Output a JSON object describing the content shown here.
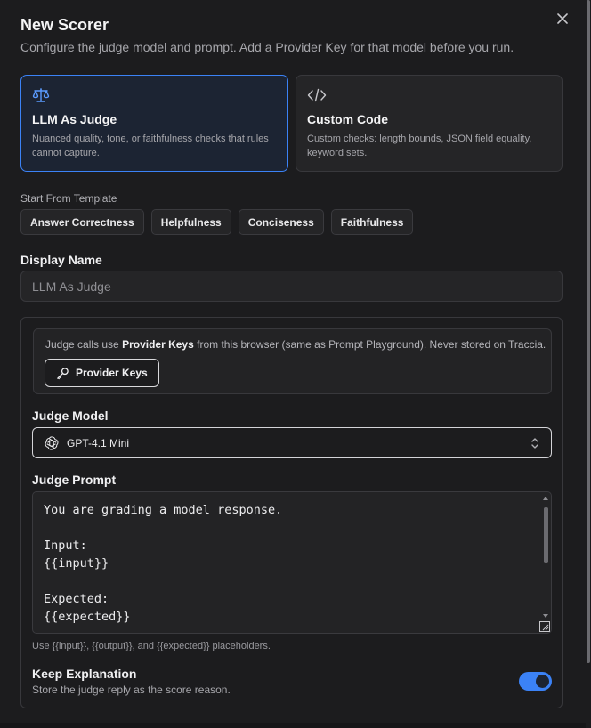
{
  "dialog": {
    "title": "New Scorer",
    "subtitle": "Configure the judge model and prompt. Add a Provider Key for that model before you run."
  },
  "scorer_types": [
    {
      "icon": "scale-icon",
      "title": "LLM As Judge",
      "description": "Nuanced quality, tone, or faithfulness checks that rules cannot capture.",
      "selected": true
    },
    {
      "icon": "code-icon",
      "title": "Custom Code",
      "description": "Custom checks: length bounds, JSON field equality, keyword sets.",
      "selected": false
    }
  ],
  "templates": {
    "label": "Start From Template",
    "items": [
      "Answer Correctness",
      "Helpfulness",
      "Conciseness",
      "Faithfulness"
    ]
  },
  "display_name": {
    "label": "Display Name",
    "placeholder": "LLM As Judge"
  },
  "notice": {
    "prefix": "Judge calls use ",
    "bold": "Provider Keys",
    "suffix": " from this browser (same as Prompt Playground). Never stored on Traccia.",
    "button_label": "Provider Keys"
  },
  "judge_model": {
    "label": "Judge Model",
    "value": "GPT-4.1 Mini"
  },
  "judge_prompt": {
    "label": "Judge Prompt",
    "value": "You are grading a model response.\n\nInput:\n{{input}}\n\nExpected:\n{{expected}}",
    "hint": "Use {{input}}, {{output}}, and {{expected}} placeholders."
  },
  "keep_explanation": {
    "label": "Keep Explanation",
    "description": "Store the judge reply as the score reason.",
    "enabled": true
  },
  "colors": {
    "accent": "#3b82f6",
    "background": "#1c1c1e",
    "selected_card_bg": "#1c2433"
  }
}
